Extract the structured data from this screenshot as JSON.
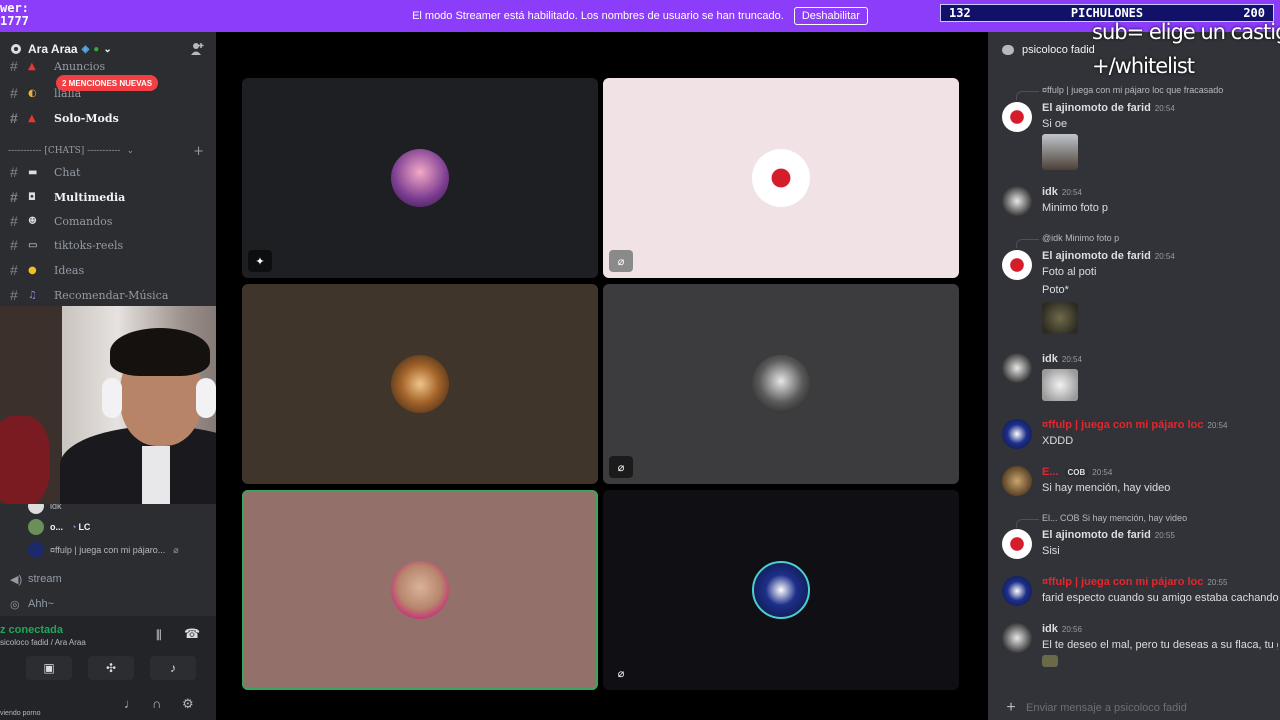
{
  "stream_corner": {
    "line1": "wer:",
    "line2": "1777"
  },
  "banner": {
    "text": "El modo Streamer está habilitado. Los nombres de usuario se han truncado.",
    "button": "Deshabilitar"
  },
  "goal": {
    "left": "132",
    "title": "PICHULONES",
    "right": "200"
  },
  "server": {
    "name": "Ara Araa"
  },
  "channels": [
    {
      "label": "Anuncios"
    },
    {
      "label": "llalla"
    },
    {
      "label": "Solo-Mods"
    }
  ],
  "mention_pill": "2 MENCIONES NUEVAS",
  "category": "----------- [CHATS] -----------",
  "chat_channels": [
    {
      "label": "Chat"
    },
    {
      "label": "Multimedia"
    },
    {
      "label": "Comandos"
    },
    {
      "label": "tiktoks-reels"
    },
    {
      "label": "Ideas"
    },
    {
      "label": "Recomendar-Música"
    }
  ],
  "voice_users": [
    {
      "name": "idk"
    },
    {
      "name": "o..."
    },
    {
      "tag": "LC"
    },
    {
      "name": "¤ffulp | juega con mi pájaro..."
    }
  ],
  "voice_channels": [
    {
      "label": "stream"
    },
    {
      "label": "Ahh~"
    }
  ],
  "voice_panel": {
    "status": "z conectada",
    "sub": "sicoloco fadid / Ara Araa"
  },
  "user_bar": {
    "status": "viendo porno"
  },
  "chat": {
    "header": "psicoloco fadid",
    "overlay_line1": "sub= elige un castigo",
    "overlay_line2": "+/whitelist",
    "input_placeholder": "Enviar mensaje a psicoloco fadid",
    "messages": [
      {
        "reply": "¤ffulp | juega con mi pájaro loc  que fracasado",
        "name": "El ajinomoto de farid",
        "time": "20:54",
        "text": "Si oe"
      },
      {
        "name": "idk",
        "time": "20:54",
        "text": "Minimo foto p"
      },
      {
        "reply": "@idk  Minimo foto p",
        "name": "El ajinomoto de farid",
        "time": "20:54",
        "text": "Foto al poti",
        "text2": "Poto*"
      },
      {
        "name": "idk",
        "time": "20:54",
        "text": ""
      },
      {
        "name": "¤ffulp | juega con mi pájaro loc",
        "time": "20:54",
        "text": "XDDD"
      },
      {
        "name": "E...",
        "tag": "COB",
        "time": "20:54",
        "text": "Si hay mención, hay video"
      },
      {
        "reply": "El...  COB  Si hay mención, hay video",
        "name": "El ajinomoto de farid",
        "time": "20:55",
        "text": "Sisi"
      },
      {
        "name": "¤ffulp | juega con mi pájaro loc",
        "time": "20:55",
        "text": "farid especto cuando su amigo estaba cachando"
      },
      {
        "name": "idk",
        "time": "20:56",
        "text": "El te deseo el mal, pero tu deseas a su flaca, tu g"
      }
    ]
  }
}
